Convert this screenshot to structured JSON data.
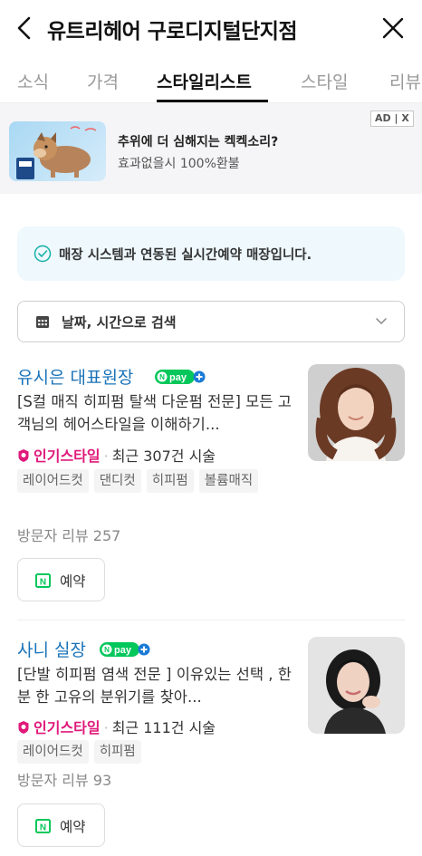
{
  "header": {
    "title": "유트리헤어 구로디지털단지점",
    "back_icon": "chevron-left-icon",
    "close_icon": "close-icon"
  },
  "tabs": [
    {
      "label": "소식",
      "active": false
    },
    {
      "label": "가격",
      "active": false
    },
    {
      "label": "스타일리스트",
      "active": true
    },
    {
      "label": "스타일",
      "active": false
    },
    {
      "label": "리뷰",
      "active": false
    }
  ],
  "ad": {
    "title": "추위에 더 심해지는 켁켁소리?",
    "subtitle": "효과없을시 100%환불",
    "badge": "AD | X"
  },
  "notice": {
    "text": "매장 시스템과 연동된 실시간예약 매장입니다.",
    "icon": "check-circle-icon"
  },
  "search": {
    "label": "날짜, 시간으로 검색",
    "icon": "calendar-icon"
  },
  "designers": [
    {
      "name": "유시은 대표원장",
      "description": "[S컬 매직 히피펌 탈색 다운펌 전문] 모든 고객님의 헤어스타일을 이해하기...",
      "popular_label": "인기스타일",
      "count_text": "최근 307건 시술",
      "tags": [
        "레이어드컷",
        "댄디컷",
        "히피펌",
        "볼륨매직"
      ],
      "review": "방문자 리뷰 257",
      "book_label": "예약"
    },
    {
      "name": "사니 실장",
      "description": "[단발 히피펌 염색 전문 ] 이유있는 선택 , 한 분 한 고유의 분위기를 찾아...",
      "popular_label": "인기스타일",
      "count_text": "최근 111건 시술",
      "tags": [
        "레이어드컷",
        "히피펌"
      ],
      "review": "방문자 리뷰 93",
      "book_label": "예약"
    }
  ],
  "npay_label": "pay",
  "colors": {
    "accent_blue": "#1a73b8",
    "popular_pink": "#e0197a",
    "npay_green": "#03c75a",
    "notice_bg": "#eef8fd"
  }
}
